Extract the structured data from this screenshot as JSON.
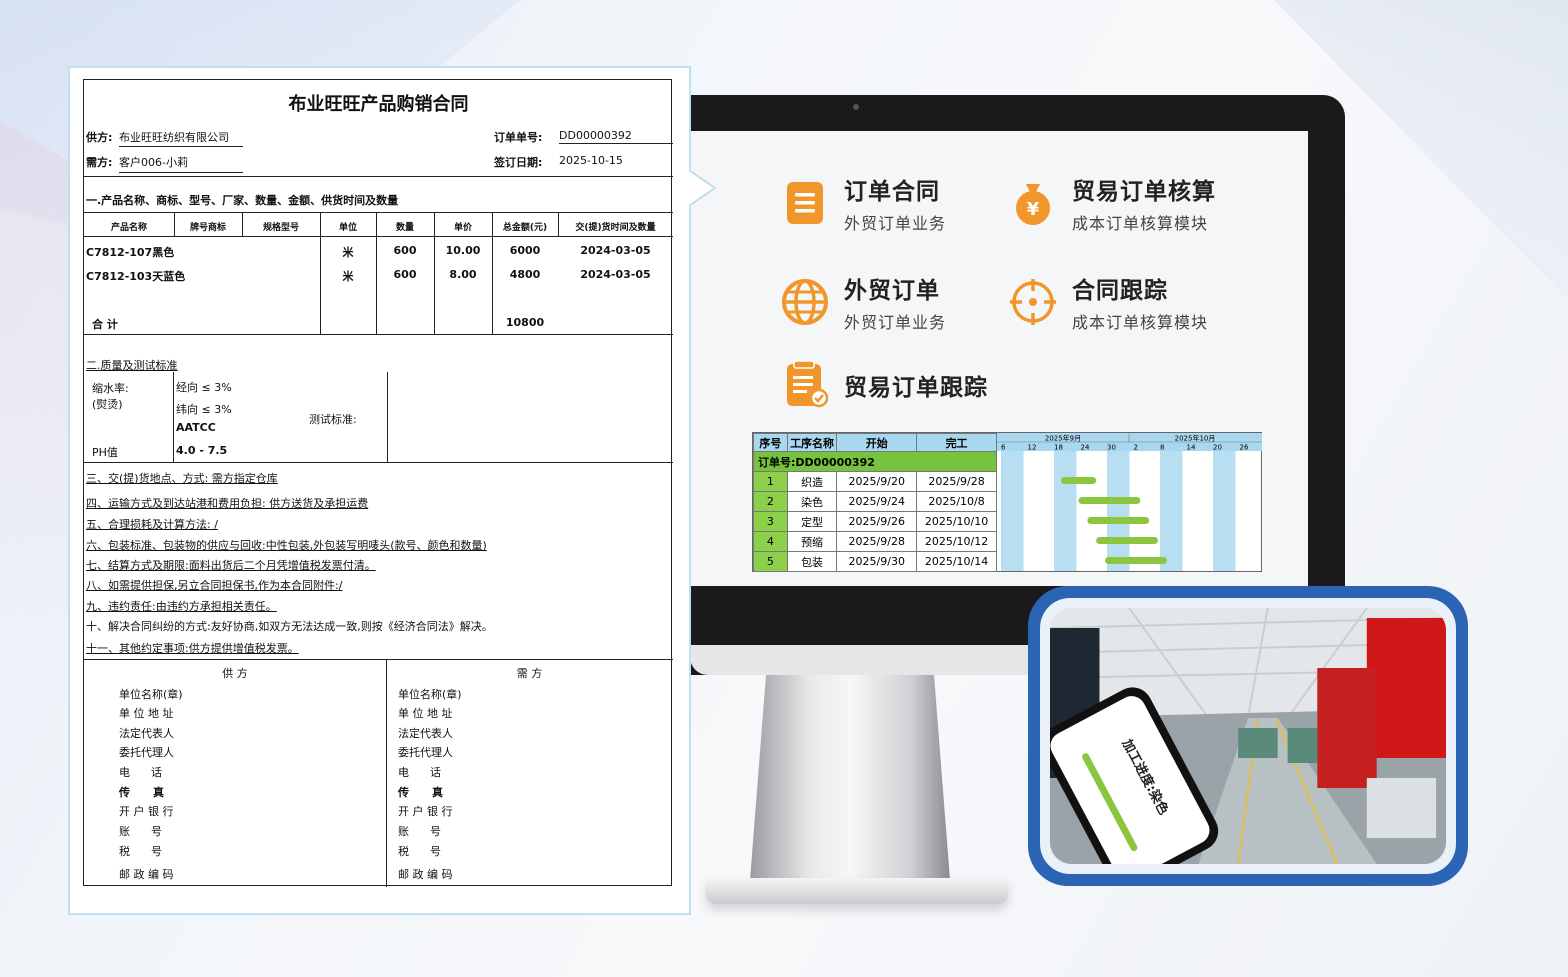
{
  "contract": {
    "title": "布业旺旺产品购销合同",
    "supplier_label": "供方:",
    "supplier_value": "布业旺旺纺织有限公司",
    "buyer_label": "需方:",
    "buyer_value": "客户006-小莉",
    "order_no_label": "订单单号:",
    "order_no_value": "DD00000392",
    "sign_date_label": "签订日期:",
    "sign_date_value": "2025-10-15",
    "section1": "一.产品名称、商标、型号、厂家、数量、金额、供货时间及数量",
    "columns": [
      "产品名称",
      "牌号商标",
      "规格型号",
      "单位",
      "数量",
      "单价",
      "总金额(元)",
      "交(提)货时间及数量"
    ],
    "rows": [
      [
        "C7812-107黑色",
        "",
        "",
        "米",
        "600",
        "10.00",
        "6000",
        "2024-03-05"
      ],
      [
        "C7812-103天蓝色",
        "",
        "",
        "米",
        "600",
        "8.00",
        "4800",
        "2024-03-05"
      ]
    ],
    "total_label": "合  计",
    "total_value": "10800",
    "section2": "二.质量及测试标准",
    "shrink_label": "缩水率:",
    "shrink_sub": "(熨烫)",
    "warp": "经向 ≤ 3%",
    "weft": "纬向 ≤ 3%",
    "aatcc": "AATCC",
    "test_std": "测试标准:",
    "ph_label": "PH值",
    "ph_value": "4.0 - 7.5",
    "terms": [
      "三、交(提)货地点、方式:                    需方指定仓库",
      "四、运输方式及到达站港和费用负担:        供方送货及承担运费",
      "五、合理损耗及计算方法:                    /",
      "六、包装标准、包装物的供应与回收:中性包装,外包装写明唛头(款号、颜色和数量)",
      "七、结算方式及期限:面料出货后二个月凭增值税发票付清。",
      "八、如需提供担保,另立合同担保书,作为本合同附件:/",
      "九、违约责任:由违约方承担相关责任。",
      "十、解决合同纠纷的方式:友好协商,如双方无法达成一致,则按《经济合同法》解决。",
      "十一、其他约定事项:供方提供增值税发票。"
    ],
    "supplier_col_title": "供  方",
    "buyer_col_title": "需  方",
    "party_fields": [
      "单位名称(章)",
      "单 位 地 址",
      "法定代表人",
      "委托代理人",
      "电      话",
      "传      真",
      "开 户 银 行",
      "账      号",
      "税      号",
      "邮 政 编 码"
    ]
  },
  "features": [
    {
      "title": "订单合同",
      "sub": "外贸订单业务",
      "icon": "document-list-icon"
    },
    {
      "title": "贸易订单核算",
      "sub": "成本订单核算模块",
      "icon": "money-bag-icon"
    },
    {
      "title": "外贸订单",
      "sub": "外贸订单业务",
      "icon": "globe-icon"
    },
    {
      "title": "合同跟踪",
      "sub": "成本订单核算模块",
      "icon": "target-icon"
    },
    {
      "title": "贸易订单跟踪",
      "sub": "",
      "icon": "clipboard-check-icon"
    }
  ],
  "gantt": {
    "headers": [
      "序号",
      "工序名称",
      "开始",
      "完工"
    ],
    "order_label": "订单号:DD00000392",
    "month1": "2025年9月",
    "month2": "2025年10月",
    "days": [
      "6",
      "12",
      "18",
      "24",
      "30",
      "2",
      "8",
      "14",
      "20",
      "26"
    ],
    "tasks": [
      {
        "no": "1",
        "name": "织造",
        "start": "2025/9/20",
        "end": "2025/9/28"
      },
      {
        "no": "2",
        "name": "染色",
        "start": "2025/9/24",
        "end": "2025/10/8"
      },
      {
        "no": "3",
        "name": "定型",
        "start": "2025/9/26",
        "end": "2025/10/10"
      },
      {
        "no": "4",
        "name": "预缩",
        "start": "2025/9/28",
        "end": "2025/10/12"
      },
      {
        "no": "5",
        "name": "包装",
        "start": "2025/9/30",
        "end": "2025/10/14"
      }
    ]
  },
  "phone": {
    "progress_text": "加工进度:染色"
  },
  "colors": {
    "accent": "#f0962a",
    "green": "#8cc63f",
    "blue_frame": "#2b63b5",
    "gantt_header": "#a8d8f0"
  }
}
